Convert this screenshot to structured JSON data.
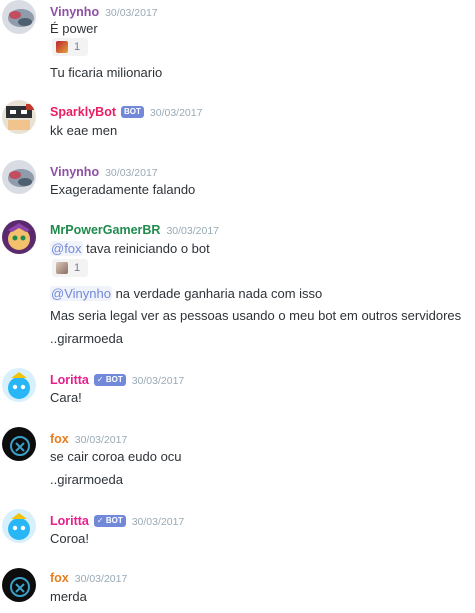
{
  "colors": {
    "vinynho": "#8e4fa6",
    "sparklybot": "#e91e63",
    "mrpower": "#1f8b4c",
    "loritta": "#e91e8c",
    "fox": "#e67e22",
    "mention": "#7289da",
    "badge": "#7289da",
    "timestamp": "#99aab5"
  },
  "messages": [
    {
      "author": "Vinynho",
      "timestamp": "30/03/2017",
      "lines": [
        "É power"
      ],
      "reaction": {
        "icon": "emoji-icon",
        "count": "1"
      },
      "more_lines": [
        "Tu ficaria milionario"
      ]
    },
    {
      "author": "SparklyBot",
      "badge": "BOT",
      "timestamp": "30/03/2017",
      "lines": [
        "kk eae men"
      ]
    },
    {
      "author": "Vinynho",
      "timestamp": "30/03/2017",
      "lines": [
        "Exageradamente falando"
      ]
    },
    {
      "author": "MrPowerGamerBR",
      "timestamp": "30/03/2017",
      "line1": {
        "mention": "@fox",
        "text": " tava reiniciando o bot"
      },
      "reaction": {
        "icon": "emoji-icon",
        "count": "1"
      },
      "line2": {
        "mention": "@Vinynho",
        "text": " na verdade ganharia nada com isso"
      },
      "line3": "Mas seria legal ver as pessoas usando o meu bot em outros servidores",
      "line4": "..girarmoeda"
    },
    {
      "author": "Loritta",
      "badge": "✓ BOT",
      "timestamp": "30/03/2017",
      "lines": [
        "Cara!"
      ]
    },
    {
      "author": "fox",
      "timestamp": "30/03/2017",
      "lines": [
        "se cair coroa eudo ocu",
        "..girarmoeda"
      ]
    },
    {
      "author": "Loritta",
      "badge": "✓ BOT",
      "timestamp": "30/03/2017",
      "lines": [
        "Coroa!"
      ]
    },
    {
      "author": "fox",
      "timestamp": "30/03/2017",
      "lines": [
        "merda"
      ]
    }
  ]
}
